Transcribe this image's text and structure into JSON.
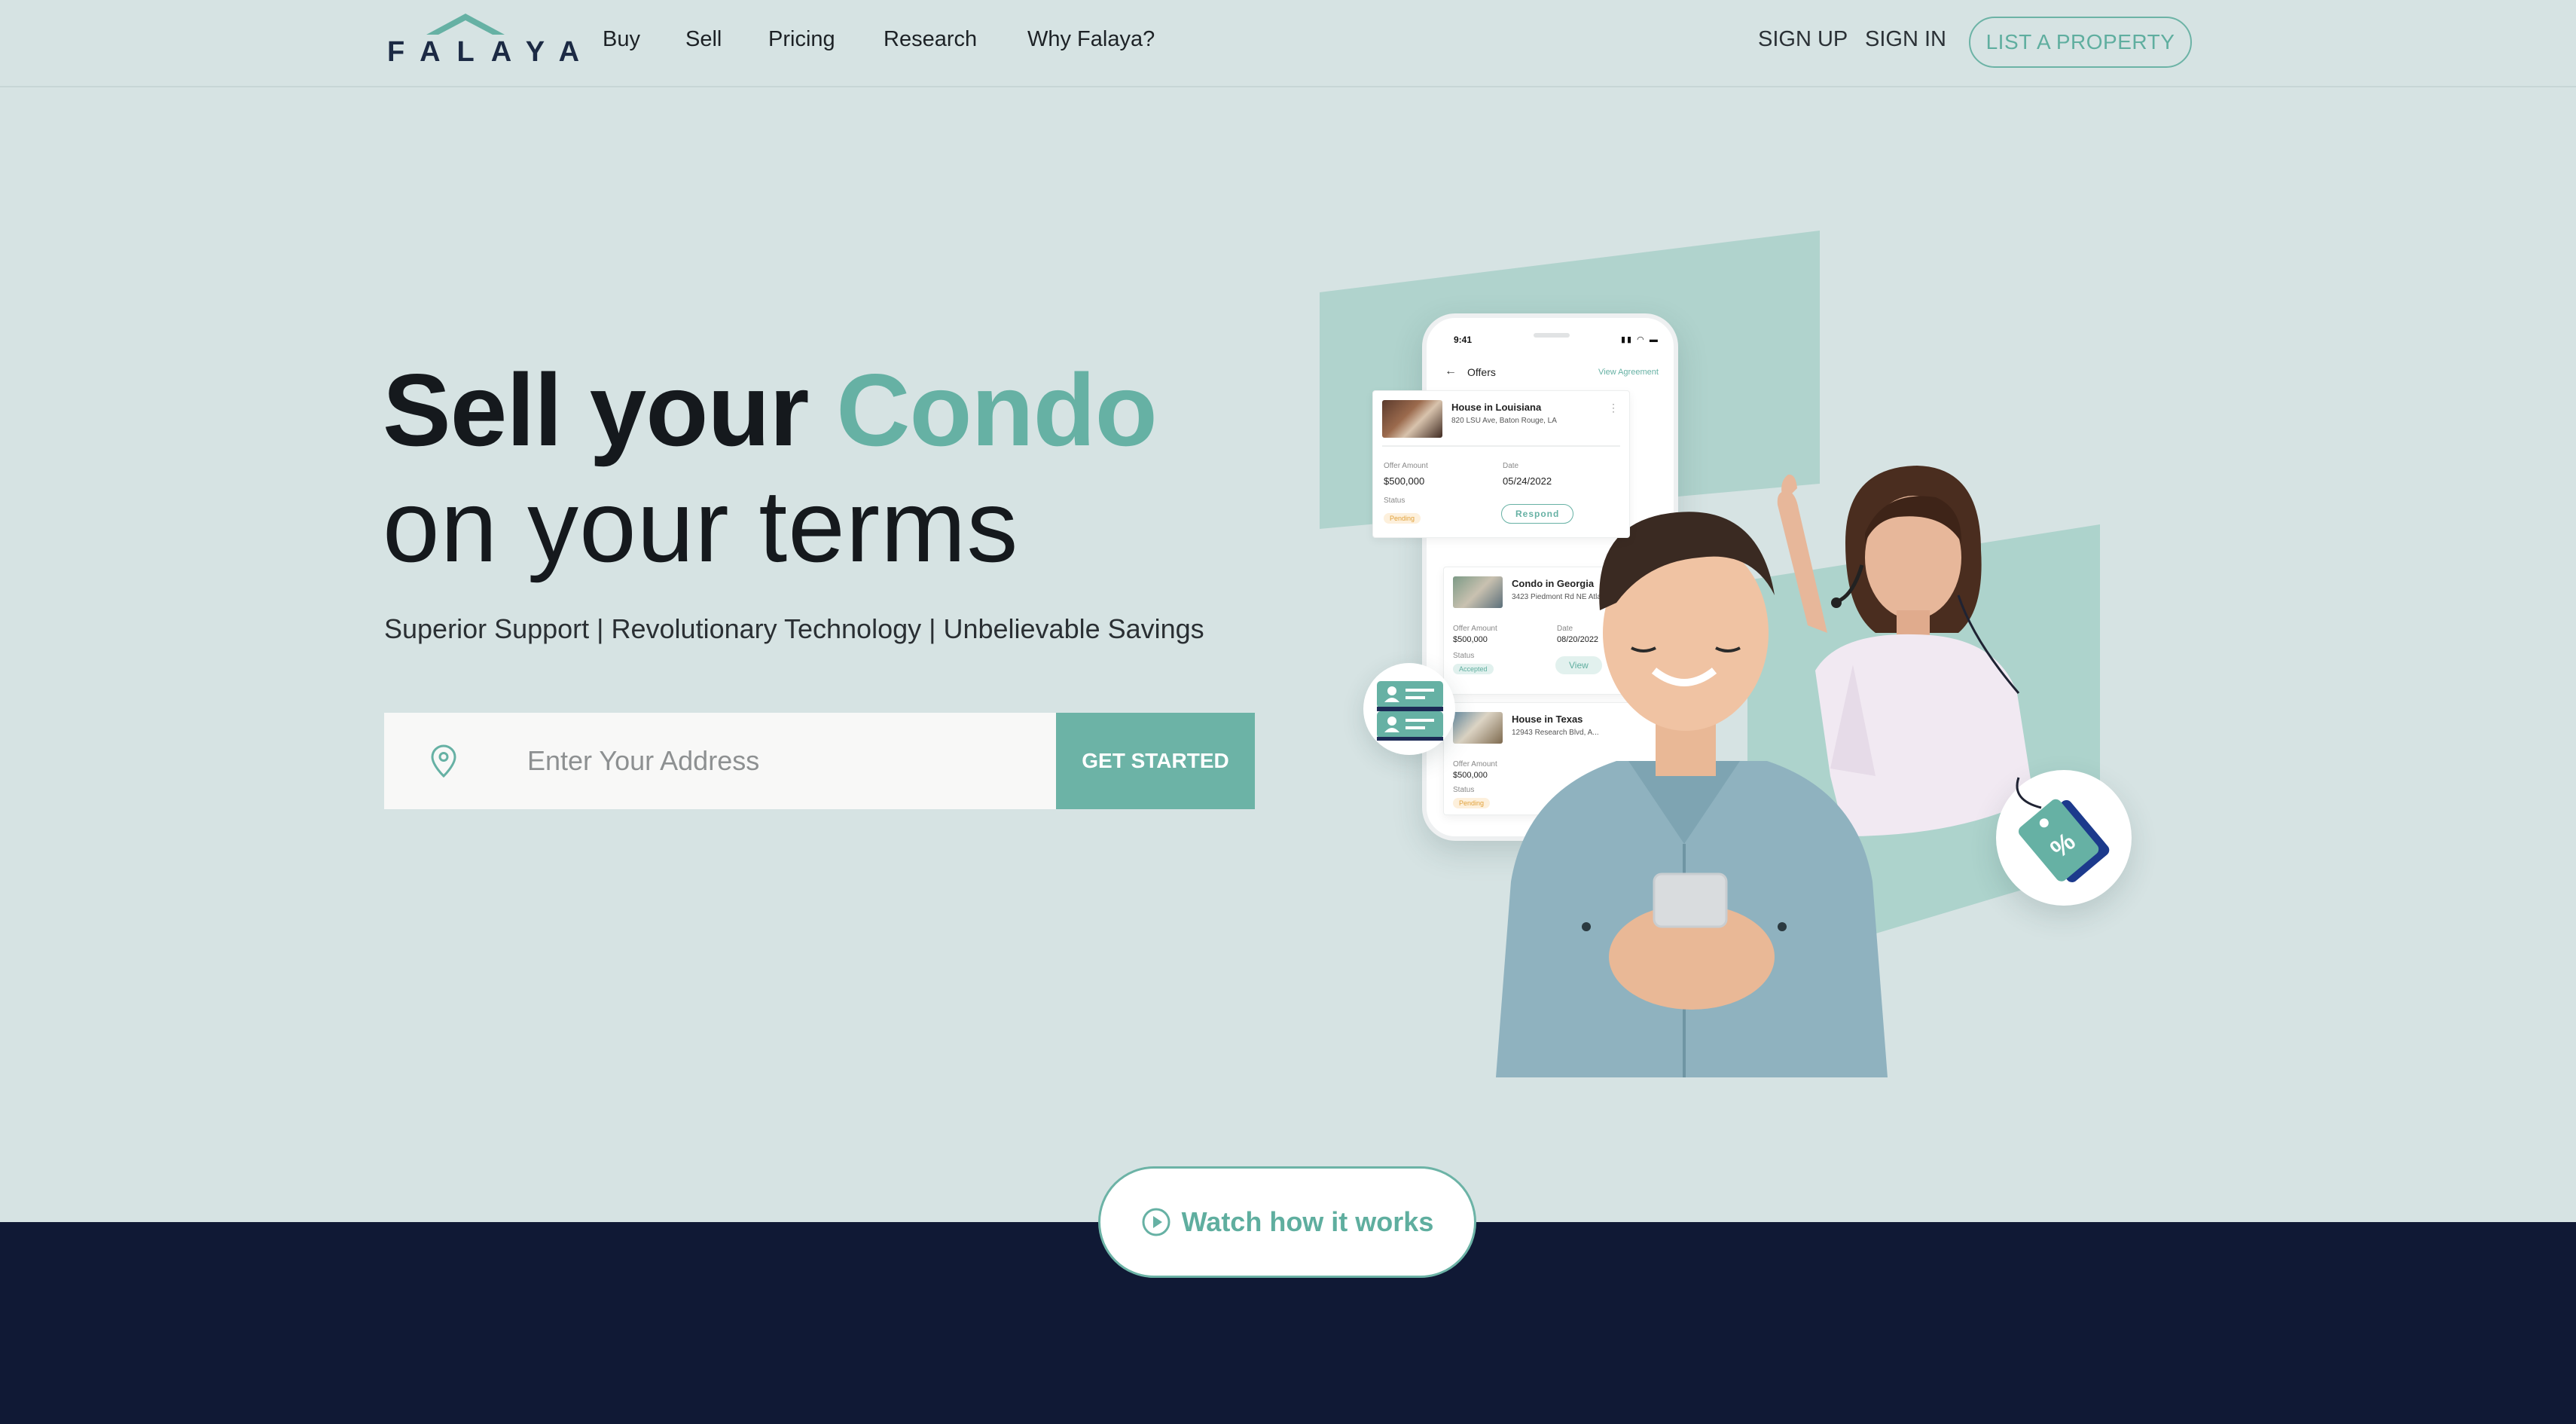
{
  "brand": {
    "logo_text": "FALAYA",
    "accent_color": "#66b1a4",
    "dark_color": "#101935",
    "background_color": "#d6e3e3"
  },
  "nav": {
    "links": [
      "Buy",
      "Sell",
      "Pricing",
      "Research",
      "Why Falaya?"
    ],
    "sign_up": "SIGN UP",
    "sign_in": "SIGN IN",
    "list_property": "LIST A PROPERTY"
  },
  "hero": {
    "title_part1": "Sell your",
    "title_accent": "Condo",
    "title_line2": "on your terms",
    "subtitle": "Superior Support | Revolutionary Technology | Unbelievable Savings",
    "search_placeholder": "Enter Your Address",
    "search_icon": "map-pin-icon",
    "cta": "GET STARTED"
  },
  "phone_app": {
    "time": "9:41",
    "status_icons": "signal wifi battery",
    "back_icon": "arrow-left-icon",
    "screen_title": "Offers",
    "view_agreement": "View Agreement",
    "offers": [
      {
        "title": "House in Louisiana",
        "address": "820 LSU Ave, Baton Rouge, LA",
        "amount_label": "Offer Amount",
        "amount": "$500,000",
        "date_label": "Date",
        "date": "05/24/2022",
        "status_label": "Status",
        "status": "Pending",
        "action": "Respond"
      },
      {
        "title": "Condo in Georgia",
        "address": "3423 Piedmont Rd NE Atlanta",
        "amount_label": "Offer Amount",
        "amount": "$500,000",
        "date_label": "Date",
        "date": "08/20/2022",
        "status_label": "Status",
        "status": "Accepted",
        "action": "View"
      },
      {
        "title": "House in Texas",
        "address": "12943 Research Blvd, A...",
        "amount_label": "Offer Amount",
        "amount": "$500,000",
        "status_label": "Status",
        "status": "Pending"
      }
    ]
  },
  "badges": {
    "id_card_icon": "id-card-icon",
    "price_tag_icon": "discount-tag-icon"
  },
  "watch": {
    "label": "Watch how it works",
    "icon": "play-circle-icon"
  }
}
